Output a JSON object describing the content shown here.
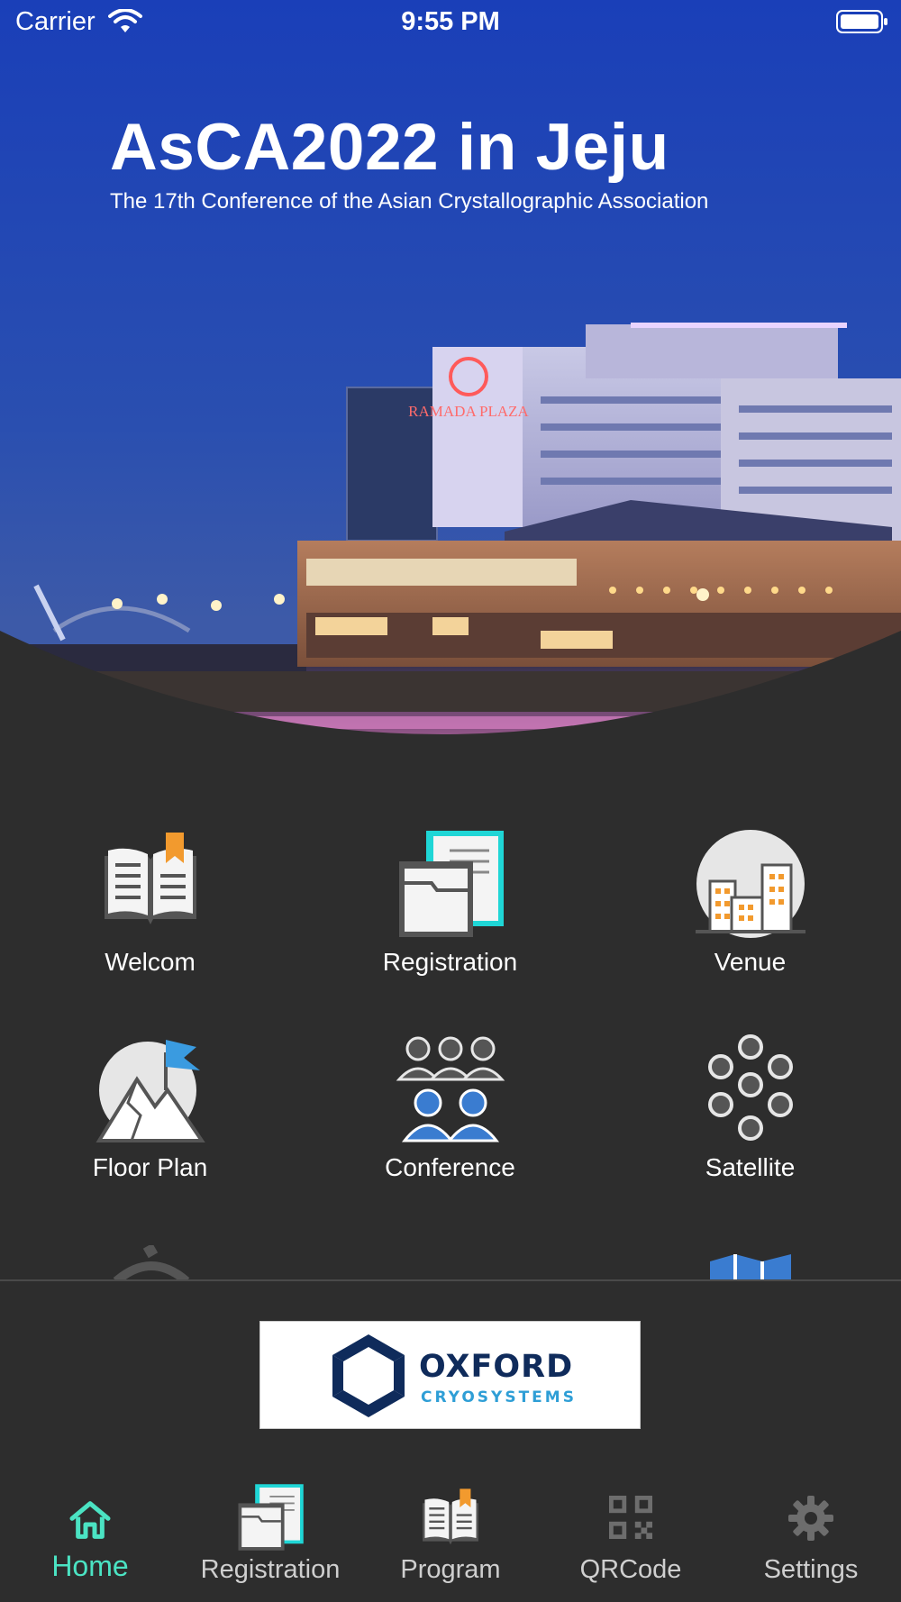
{
  "status_bar": {
    "carrier": "Carrier",
    "time": "9:55 PM"
  },
  "hero": {
    "title": "AsCA2022 in Jeju",
    "subtitle": "The 17th Conference of the Asian Crystallographic Association",
    "hotel_sign": "RAMADA PLAZA"
  },
  "menu": {
    "items": [
      {
        "label": "Welcom",
        "icon": "open-book-bookmark-icon"
      },
      {
        "label": "Registration",
        "icon": "documents-folder-icon"
      },
      {
        "label": "Venue",
        "icon": "city-buildings-icon"
      },
      {
        "label": "Floor Plan",
        "icon": "mountain-flag-icon"
      },
      {
        "label": "Conference",
        "icon": "people-group-icon"
      },
      {
        "label": "Satellite",
        "icon": "dots-cluster-icon"
      }
    ]
  },
  "sponsor": {
    "name": "OXFORD",
    "subname": "CRYOSYSTEMS"
  },
  "tabbar": {
    "tabs": [
      {
        "label": "Home",
        "icon": "home-icon",
        "active": true
      },
      {
        "label": "Registration",
        "icon": "documents-folder-icon",
        "active": false
      },
      {
        "label": "Program",
        "icon": "open-book-icon",
        "active": false
      },
      {
        "label": "QRCode",
        "icon": "qrcode-icon",
        "active": false
      },
      {
        "label": "Settings",
        "icon": "gear-icon",
        "active": false
      }
    ]
  },
  "colors": {
    "background": "#2d2d2d",
    "accent": "#4be3c3",
    "sky": "#1f3fae",
    "icon_cyan": "#1fd6d6",
    "icon_orange": "#f29a2e",
    "icon_blue": "#3a7cd0"
  }
}
